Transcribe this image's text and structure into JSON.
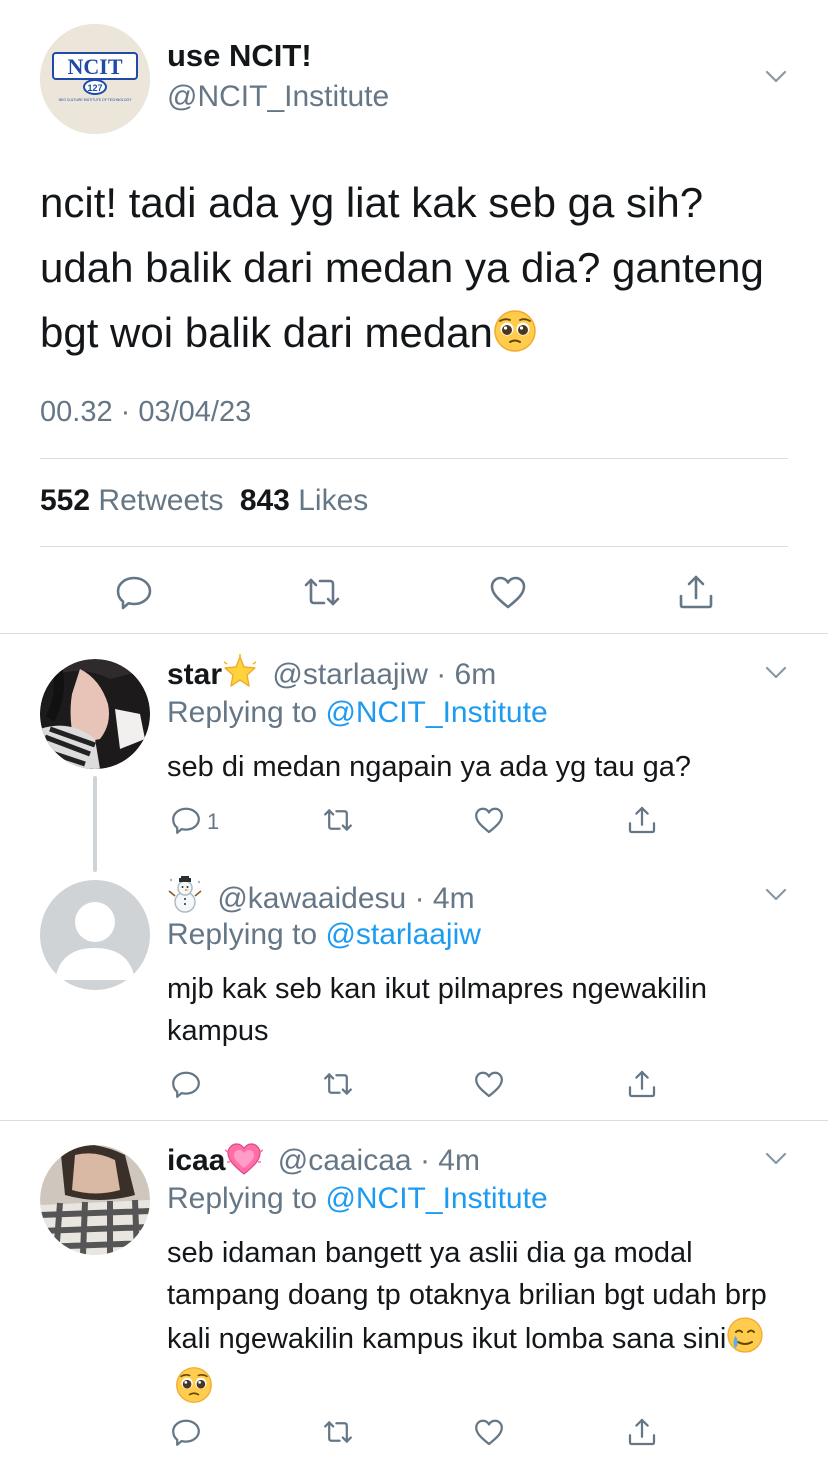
{
  "main_tweet": {
    "author_name": "use NCIT!",
    "handle": "@NCIT_Institute",
    "avatar_logo": {
      "title": "NCIT",
      "number": "127",
      "subtitle": "NEO CULTURE INSTITUTE OF TECHNOLOGY"
    },
    "text": "ncit! tadi ada yg liat kak seb ga sih? udah balik dari medan ya dia? ganteng bgt woi balik dari medan",
    "text_emoji": "pleading-face",
    "timestamp": "00.32 · 03/04/23",
    "retweets_count": "552",
    "retweets_label": "Retweets",
    "likes_count": "843",
    "likes_label": "Likes"
  },
  "replies": [
    {
      "name": "star",
      "name_emoji": "glowing-star",
      "handle": "@starlaajiw",
      "time": "· 6m",
      "replying_prefix": "Replying to",
      "replying_handle": "@NCIT_Institute",
      "text": "seb di medan ngapain ya ada yg tau ga?",
      "reply_count": "1"
    },
    {
      "name": "",
      "name_emoji": "snowman",
      "handle": "@kawaaidesu",
      "time": "· 4m",
      "replying_prefix": "Replying to",
      "replying_handle": "@starlaajiw",
      "text": "mjb kak seb kan ikut pilmapres ngewakilin kampus",
      "reply_count": ""
    },
    {
      "name": "icaa",
      "name_emoji": "growing-heart",
      "handle": "@caaicaa",
      "time": "· 4m",
      "replying_prefix": "Replying to",
      "replying_handle": "@NCIT_Institute",
      "text": "seb idaman bangett ya aslii dia ga modal tampang doang tp otaknya brilian bgt udah brp kali ngewakilin kampus ikut lomba sana sini",
      "text_emojis": [
        "crying-smile",
        "pleading-face"
      ],
      "reply_count": ""
    }
  ],
  "colors": {
    "link": "#1d9bf0",
    "muted": "#657786",
    "text": "#14171a",
    "divider": "#d9dde1"
  },
  "icons": [
    "chevron-down-icon",
    "reply-icon",
    "retweet-icon",
    "like-icon",
    "share-icon"
  ]
}
